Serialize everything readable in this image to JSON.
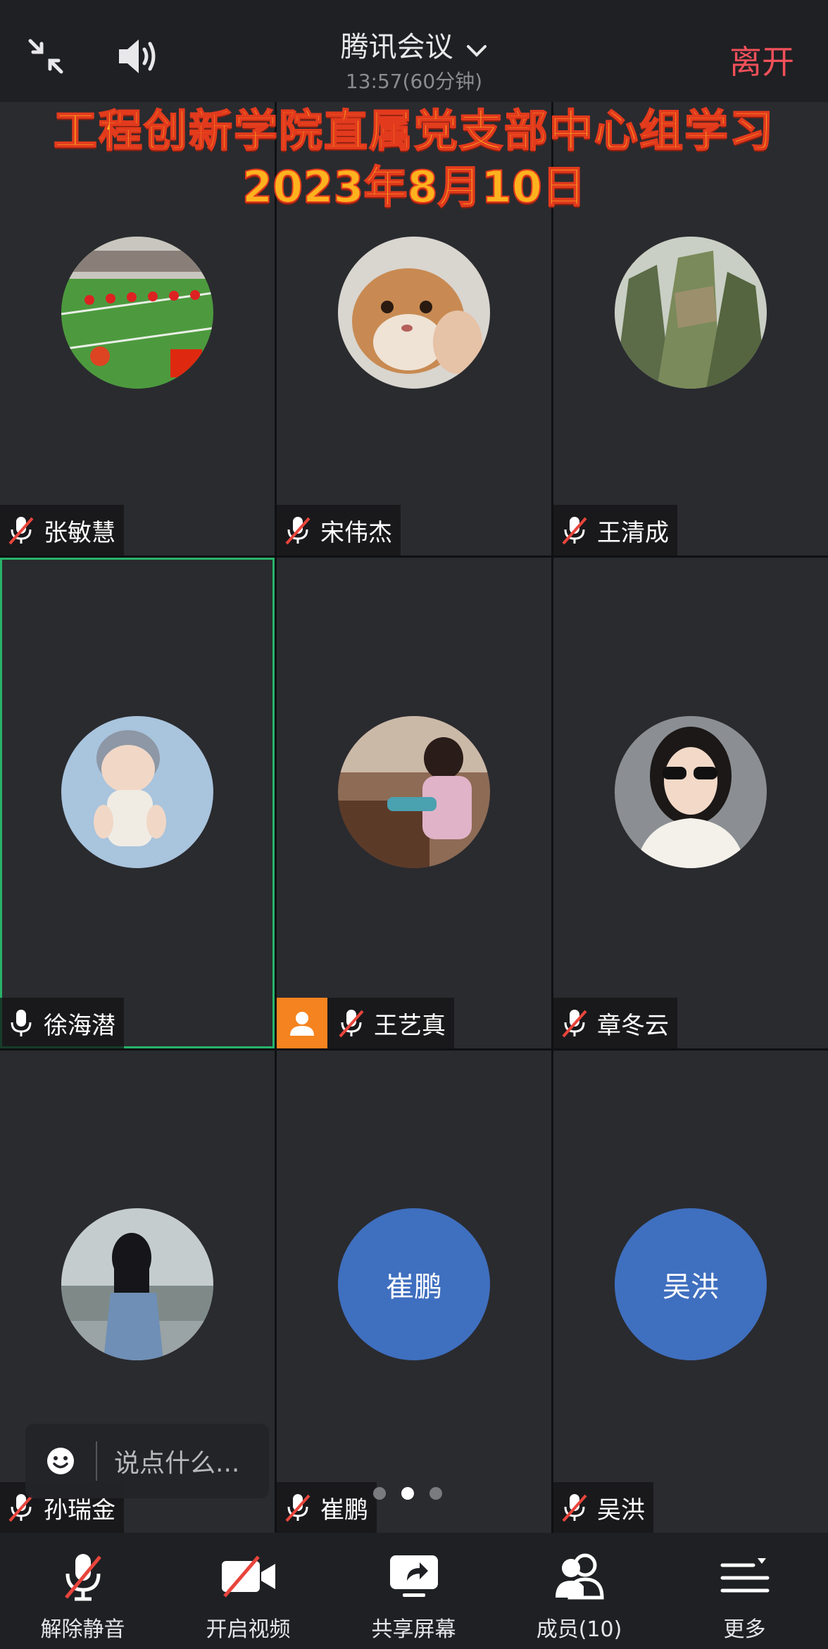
{
  "topbar": {
    "meeting_title": "腾讯会议",
    "duration": "13:57(60分钟)",
    "leave_label": "离开"
  },
  "banner": {
    "line1": "工程创新学院直属党支部中心组学习",
    "line2": "2023年8月10日"
  },
  "participants": [
    {
      "name": "张敏慧",
      "muted": true
    },
    {
      "name": "宋伟杰",
      "muted": true
    },
    {
      "name": "王清成",
      "muted": true
    },
    {
      "name": "徐海潜",
      "muted": false,
      "speaking": true
    },
    {
      "name": "王艺真",
      "muted": true,
      "host": true
    },
    {
      "name": "章冬云",
      "muted": true
    },
    {
      "name": "孙瑞金",
      "muted": true
    },
    {
      "name": "崔鹏",
      "muted": true,
      "avatar_text": "崔鹏"
    },
    {
      "name": "吴洪",
      "muted": true,
      "avatar_text": "吴洪"
    }
  ],
  "chat": {
    "placeholder": "说点什么..."
  },
  "pagination": {
    "pages": 3,
    "current": 2
  },
  "toolbar": {
    "unmute_label": "解除静音",
    "video_label": "开启视频",
    "share_label": "共享屏幕",
    "members_label": "成员(10)",
    "more_label": "更多"
  },
  "colors": {
    "leave": "#f2505a",
    "avatar_blue": "#3f6fbf",
    "host_badge": "#f5831f",
    "active_border": "#27b36a",
    "muted_slash": "#e8453c"
  }
}
